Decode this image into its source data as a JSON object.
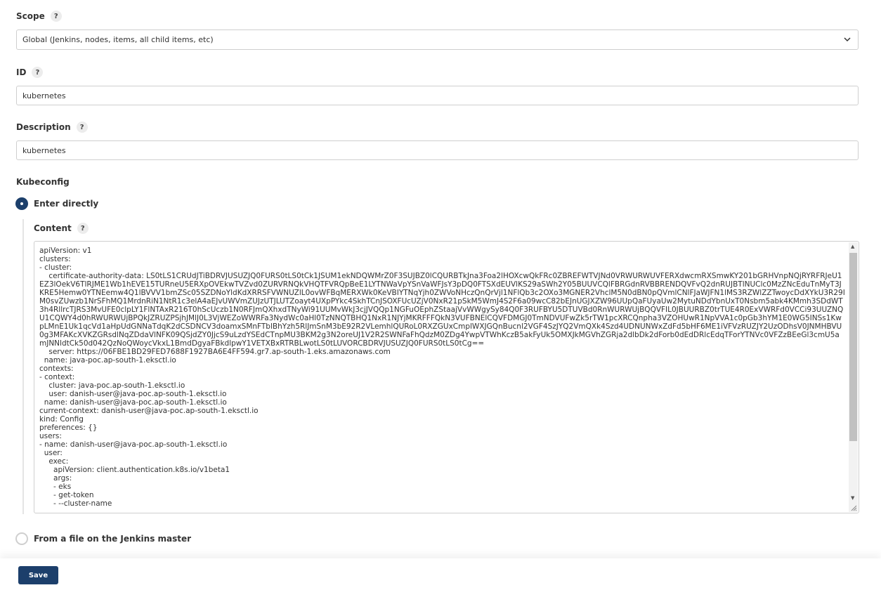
{
  "scope": {
    "label": "Scope",
    "help": "?",
    "selected": "Global (Jenkins, nodes, items, all child items, etc)"
  },
  "id_field": {
    "label": "ID",
    "help": "?",
    "value": "kubernetes"
  },
  "description": {
    "label": "Description",
    "help": "?",
    "value": "kubernetes"
  },
  "kubeconfig": {
    "label": "Kubeconfig",
    "option_enter_directly": "Enter directly",
    "option_enter_directly_selected": true,
    "content_label": "Content",
    "content_help": "?",
    "content": "apiVersion: v1\nclusters:\n- cluster:\n    certificate-authority-data: LS0tLS1CRUdJTiBDRVJUSUZJQ0FURS0tLS0tCk1JSUM1ekNDQWMrZ0F3SUJBZ0lCQURBTkJna3Foa2lHOXcwQkFRc0ZBREFWTVJNd0VRWURWUVFERXdwcmRXSmwKY201bGRHVnpNQjRYRFRJeU1EZ3lOekV6TlRJME1Wb1hEVE15TURneU5ERXpOVEkwTVZvd0ZURVRNQkVHQTFVRQpBeE1LYTNWaVpYSnVaWFJsY3pDQ0FTSXdEUVlKS29aSWh2Y05BUUVCQlFBRGdnRVBBRENDQVFvQ2dnRUJBTlNUClc0MzZNcEduTnMyT3JKRE5Hemw0YTNEemw4Q1lBVVV1bmZSc05SZDNoYldKdXRRSFVWNUZlL0ovWFBqMERXWk0KeVBIYTNqYjh0ZWVoNHczQnQrVjl1NFlQb3c2OXo3MGNER2VhclM5N0dBN0pQVmlCNlFJaWJFN1lMS3RZWlZZTwoycDdXYkU3R29IM0svZUwzb1NrSFhMQ1MrdnRiN1NtR1c3elA4aEJvUWVmZUJzUTJLUTZoayt4UXpPYkc4SkhTCnJSOXFUcUZjV0NxR21pSkM5WmJ4S2F6a09wcC82bEJnUGJXZW96UUpQaFUyaUw2MytuNDdYbnUxT0Nsbm5abk4KMmh3SDdWT3h4RllrcTJRS3MvUFE0clpLY1FlNTAxR216T0hScUczb1N0RFJmQXhxdTNyWi91UUMvWkJ3cjJVQQp1NGFuOEphZStaajVvWWgySy84Q0F3RUFBYU5DTUVBd0RnWURWUjBQQVFIL0JBUURBZ0trTUE4R0ExVWRFd0VCCi93UUZNQU1CQWY4d0hRWURWUjBPQkJZRUZPSjhJMlJ0L3VjWEZoWWRFa3NydWc0aHl0TzNNQTBHQ1NxR1NJYjMKRFFFQkN3VUFBNElCQVFDMGJ0TmNDVUFwZk5rTW1pcXRCQnpha3VZOHUwR1NpVVA1c0pGb3hYM1E0WG5INSs1KwpLMnE1Uk1qcVd1aHpUdGNNaTdqK2dCSDNCV3doamxSMnFTblBhYzh5RlJmSnM3bE92R2VLemhlQURoL0RXZGUxCmplWXJGQnBucnl2VGF4SzJYQ2VmQXk4Szd4UDNUNWxZdFd5bHF6ME1iVFVzRUZJY2UzODhsV0JNMHBVU0g3MFAKcXVKZGRsdlNqZDdaVlNFK09QSjdZY0JjcS9uLzdYSEdCTnpMU3BKM2g3N2oreUJ1V2R2SWNFaFhQdzM0ZDg4YwpVTWhKczB5akFyUk5OMXJkMGVhZGRja2dlbDk2dForb0dEdDRlcEdqTForYTNVc0VFZzBEeGl3cmU5amJNNldtCk50d042QzNoQWoycVkxL1BmdDgyaFBkdlpwY1VETXBxRTRBLwotLS0tLUVORCBDRVJUSUZJQ0FURS0tLS0tCg==\n    server: https://06FBE1BD29FED7688F1927BA6E4FF594.gr7.ap-south-1.eks.amazonaws.com\n  name: java-poc.ap-south-1.eksctl.io\ncontexts:\n- context:\n    cluster: java-poc.ap-south-1.eksctl.io\n    user: danish-user@java-poc.ap-south-1.eksctl.io\n  name: danish-user@java-poc.ap-south-1.eksctl.io\ncurrent-context: danish-user@java-poc.ap-south-1.eksctl.io\nkind: Config\npreferences: {}\nusers:\n- name: danish-user@java-poc.ap-south-1.eksctl.io\n  user:\n    exec:\n      apiVersion: client.authentication.k8s.io/v1beta1\n      args:\n      - eks\n      - get-token\n      - --cluster-name",
    "option_file_on_master": "From a file on the Jenkins master",
    "option_file_on_master_selected": false
  },
  "footer": {
    "save_label": "Save"
  },
  "colors": {
    "accent": "#1c3f6b",
    "border": "#cfcfcf"
  }
}
